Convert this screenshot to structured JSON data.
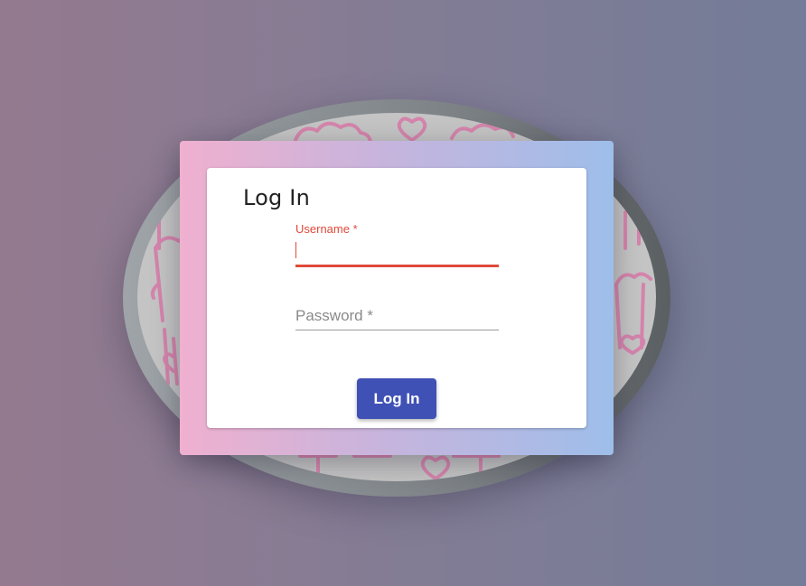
{
  "login_card": {
    "title": "Log In",
    "username": {
      "label": "Username *",
      "value": ""
    },
    "password": {
      "placeholder": "Password *",
      "value": ""
    },
    "submit_label": "Log In"
  },
  "colors": {
    "accent_error": "#e04a3a",
    "button_primary": "#3f51b5",
    "pattern_stroke": "#d97aa8"
  },
  "background_icons": [
    "popcorn-icon",
    "heart-icon"
  ]
}
